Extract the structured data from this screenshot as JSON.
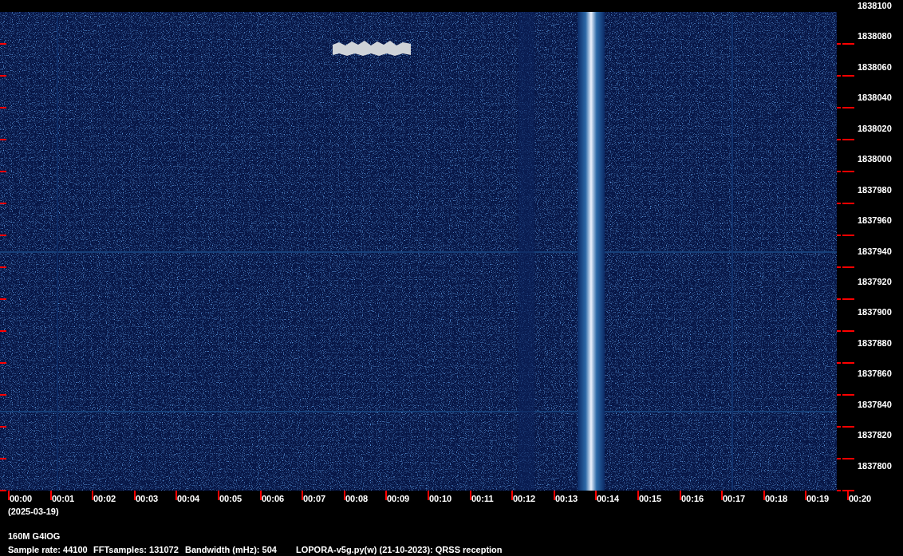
{
  "frequency_axis": {
    "labels": [
      "1838100",
      "1838080",
      "1838060",
      "1838040",
      "1838020",
      "1838000",
      "1837980",
      "1837960",
      "1837940",
      "1837920",
      "1837900",
      "1837880",
      "1837860",
      "1837840",
      "1837820",
      "1837800"
    ]
  },
  "time_axis": {
    "labels": [
      "00:00",
      "00:01",
      "00:02",
      "00:03",
      "00:04",
      "00:05",
      "00:06",
      "00:07",
      "00:08",
      "00:09",
      "00:10",
      "00:11",
      "00:12",
      "00:13",
      "00:14",
      "00:15",
      "00:16",
      "00:17",
      "00:18",
      "00:19",
      "00:20"
    ],
    "date": "(2025-03-19)"
  },
  "station": "160M G4IOG",
  "info": [
    "Sample rate: 44100",
    "FFTsamples: 131072",
    "Bandwidth (mHz): 504",
    "LOPORA-v5g.py(w) (21-10-2023): QRSS reception"
  ]
}
